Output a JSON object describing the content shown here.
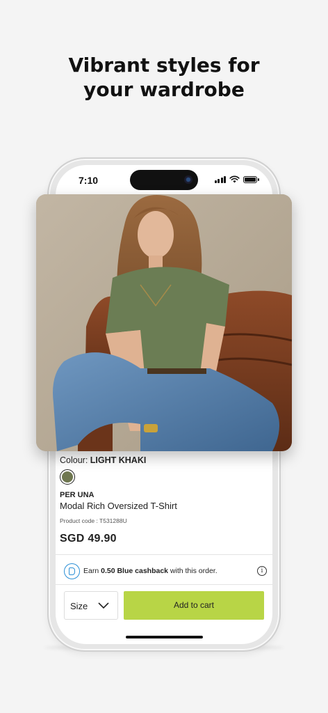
{
  "headline": {
    "line1": "Vibrant styles for",
    "line2": "your wardrobe"
  },
  "status_bar": {
    "time": "7:10",
    "icons": [
      "signal-icon",
      "wifi-icon",
      "battery-icon"
    ]
  },
  "product": {
    "image_desc_icon": "product-photo",
    "colour_label": "Colour:",
    "colour_value": "LIGHT KHAKI",
    "swatch_color": "#6f7750",
    "brand": "PER UNA",
    "name": "Modal Rich Oversized T-Shirt",
    "product_code": "Product code : T531288U",
    "price": "SGD 49.90"
  },
  "cashback": {
    "prefix": "Earn ",
    "amount": "0.50 Blue cashback",
    "suffix": " with this order.",
    "icon": "cashback-icon",
    "info_icon": "info-icon"
  },
  "actions": {
    "size_label": "Size",
    "add_to_cart": "Add to cart",
    "accent_color": "#b8d546"
  }
}
